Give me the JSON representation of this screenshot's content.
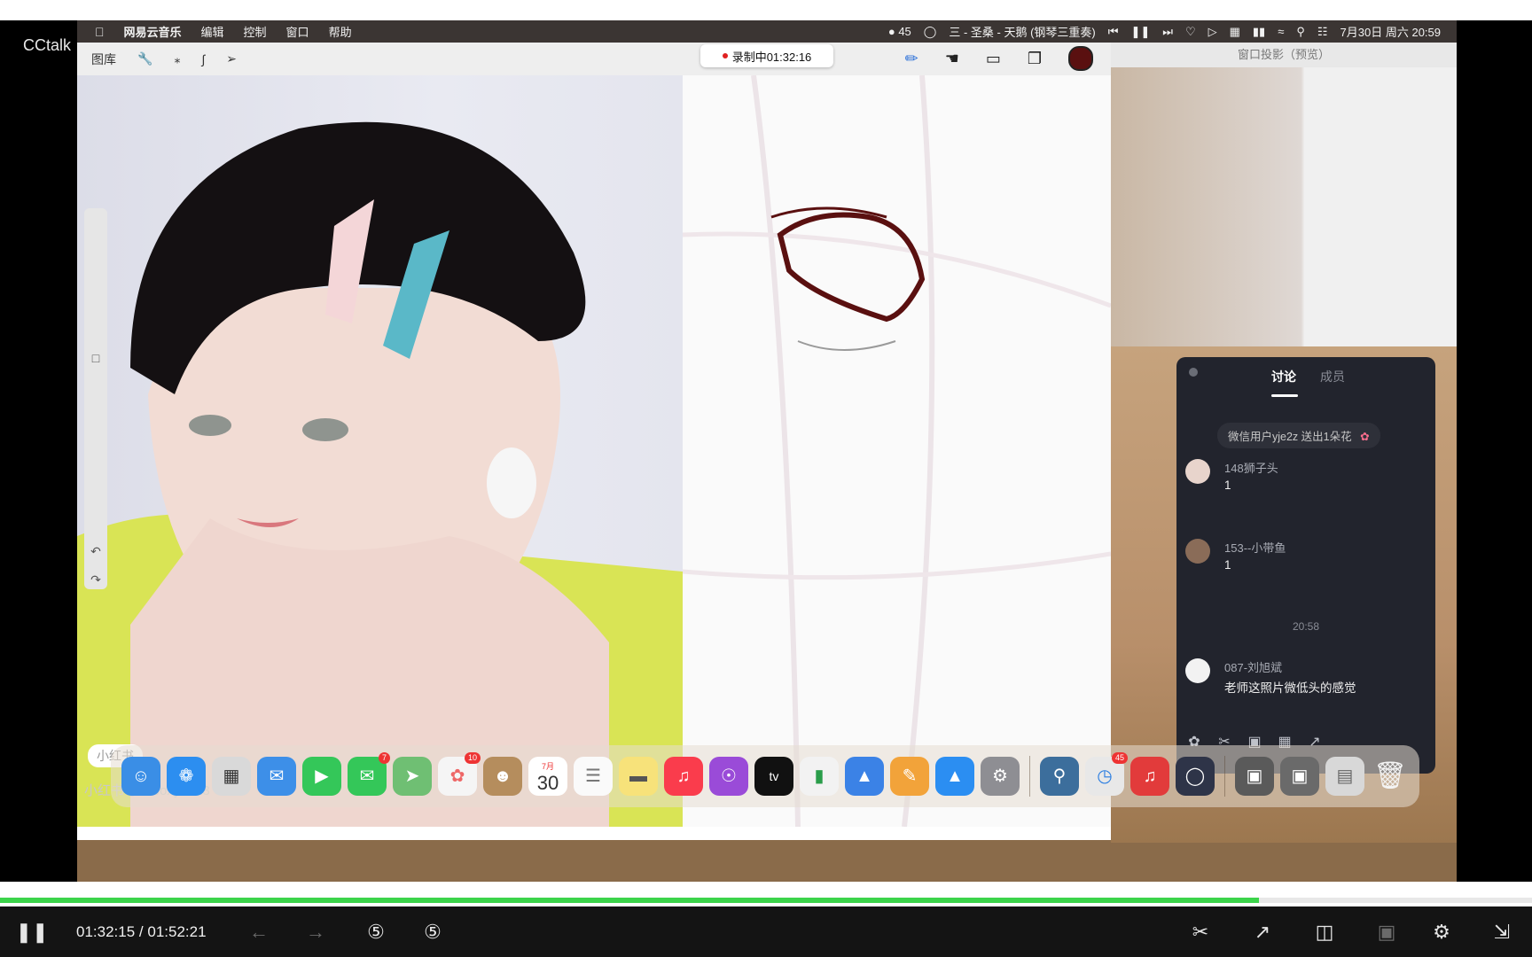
{
  "player": {
    "logo": "CCtalk",
    "current_time": "01:32:15",
    "separator": "/",
    "total_time": "01:52:21",
    "progress_fraction": 0.822,
    "accent": "#3cd44b"
  },
  "mac_menubar": {
    "app_name": "网易云音乐",
    "menus": [
      "编辑",
      "控制",
      "窗口",
      "帮助"
    ],
    "badge_count": "45",
    "now_playing": "三 - 圣桑 - 天鹅 (钢琴三重奏)",
    "datetime": "7月30日 周六 20:59"
  },
  "procreate": {
    "gallery_label": "图库",
    "recording_label": "录制中01:32:16",
    "color": "#5a1010",
    "watermark_badge": "小红书",
    "watermark_id": "小红书号：Boxy7713"
  },
  "preview_window": {
    "title": "窗口投影（预览）"
  },
  "chat": {
    "tab_discussion": "讨论",
    "tab_members": "成员",
    "gift_text": "微信用户yje2z 送出1朵花",
    "messages": [
      {
        "name": "148狮子头",
        "text": "1"
      },
      {
        "name": "153--小带鱼",
        "text": "1"
      },
      {
        "name": "087-刘旭斌",
        "text": "老师这照片微低头的感觉"
      }
    ],
    "time_divider": "20:58"
  },
  "dock": {
    "calendar_month": "7月",
    "calendar_day": "30",
    "messages_badge": "7",
    "photos_badge": "10",
    "qq_badge": "45",
    "tv_label": "tv"
  }
}
